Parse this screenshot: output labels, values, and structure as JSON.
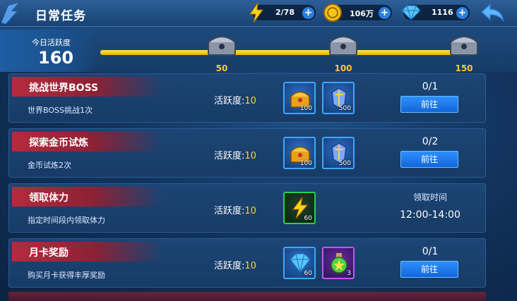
{
  "header": {
    "title": "日常任务",
    "stamina": "2/78",
    "gold": "106万",
    "diamonds": "1116",
    "back_icon": "back-arrow-icon"
  },
  "activity": {
    "label": "今日活跃度",
    "value": "160",
    "progress": 1.0,
    "milestones": [
      {
        "label": "50"
      },
      {
        "label": "100"
      },
      {
        "label": "150"
      }
    ]
  },
  "tasks": [
    {
      "name": "挑战世界BOSS",
      "desc": "世界BOSS挑战1次",
      "points_label": "活跃度:",
      "points_value": "10",
      "rewards": [
        {
          "icon": "treasure-icon",
          "count": "100"
        },
        {
          "icon": "armor-icon",
          "count": "500"
        }
      ],
      "progress": "0/1",
      "button": "前往"
    },
    {
      "name": "探索金币试炼",
      "desc": "金币试炼2次",
      "points_label": "活跃度:",
      "points_value": "10",
      "rewards": [
        {
          "icon": "treasure-icon",
          "count": "100"
        },
        {
          "icon": "armor-icon",
          "count": "500"
        }
      ],
      "progress": "0/2",
      "button": "前往"
    },
    {
      "name": "领取体力",
      "desc": "指定时间段内领取体力",
      "points_label": "活跃度:",
      "points_value": "10",
      "rewards": [
        {
          "icon": "lightning-icon",
          "count": "60"
        }
      ],
      "claim_label": "领取时间",
      "claim_time": "12:00-14:00"
    },
    {
      "name": "月卡奖励",
      "desc": "购买月卡获得丰厚奖励",
      "points_label": "活跃度:",
      "points_value": "10",
      "rewards": [
        {
          "icon": "diamond-icon",
          "count": "60"
        },
        {
          "icon": "potion-icon",
          "count": "3"
        }
      ],
      "progress": "0/1",
      "button": "前往"
    }
  ],
  "colors": {
    "accent_red": "#b42b3d",
    "button_blue": "#1266d8",
    "highlight_yellow": "#ffd23a"
  }
}
